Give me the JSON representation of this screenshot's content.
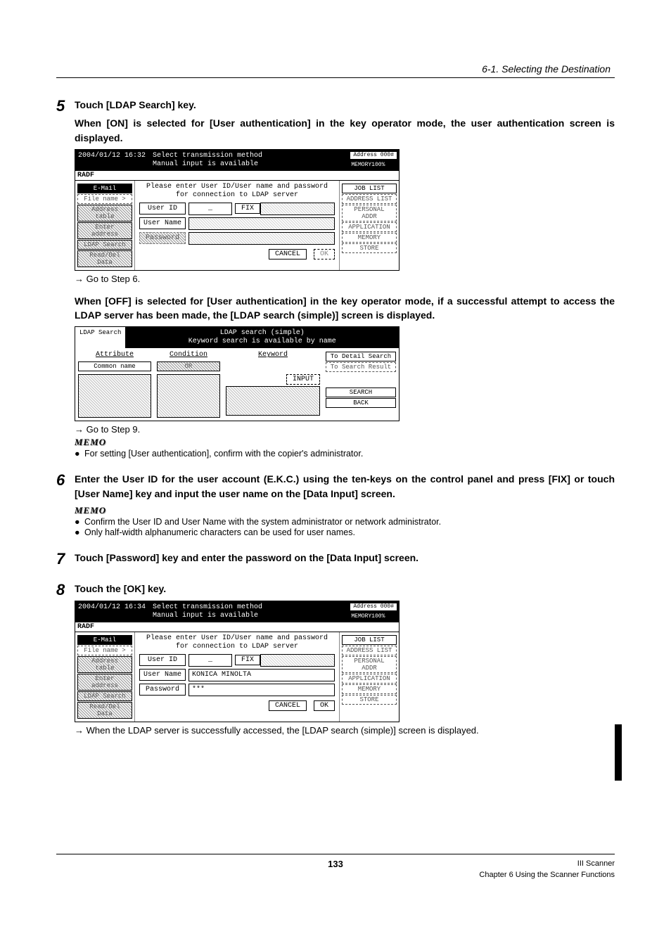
{
  "header": {
    "section": "6-1. Selecting the Destination"
  },
  "step5": {
    "num": "5",
    "title": "Touch [LDAP Search] key.",
    "para1": "When [ON] is selected for [User authentication] in the key operator mode, the user authentication screen is displayed.",
    "goto1": "→ Go to Step 6.",
    "para2": "When [OFF] is selected for [User authentication] in the key operator mode, if a successful attempt to access the LDAP server has been made, the [LDAP search (simple)] screen is displayed.",
    "goto2": "→ Go to Step 9.",
    "memo_label": "MEMO",
    "memo1": "For setting [User authentication], confirm with the copier's administrator."
  },
  "scr1": {
    "date": "2004/01/12 16:32",
    "title1": "Select transmission method",
    "title2": "Manual input is available",
    "addr_label": "Address",
    "addr_val": "000#",
    "mem": "MEMORY100%",
    "radf": "RADF",
    "tab_email": "E-Mail",
    "left_items": [
      "File name >",
      "Address table",
      "Enter address",
      "LDAP Search",
      "Read/Del Data"
    ],
    "right_items": [
      "JOB LIST",
      "ADDRESS LIST",
      "PERSONAL ADDR",
      "APPLICATION",
      "MEMORY",
      "STORE"
    ],
    "msg1": "Please enter User ID/User name and password",
    "msg2": "for connection to LDAP server",
    "f_userid": "User ID",
    "f_username": "User Name",
    "f_password": "Password",
    "userid_val": "_",
    "btn_fix": "FIX",
    "btn_cancel": "CANCEL",
    "btn_ok": "OK"
  },
  "scr2": {
    "corner": "LDAP Search",
    "title1": "LDAP search (simple)",
    "title2": "Keyword search is available by name",
    "col_attr": "Attribute",
    "col_cond": "Condition",
    "col_key": "Keyword",
    "common": "Common name",
    "or": "OR",
    "btn_input": "INPUT",
    "btn_detail": "To Detail Search",
    "btn_result": "To Search Result",
    "btn_search": "SEARCH",
    "btn_back": "BACK"
  },
  "step6": {
    "num": "6",
    "title": "Enter the User ID for the user account (E.K.C.) using the ten-keys on the control panel and press [FIX] or touch [User Name] key and input the user name on the [Data Input] screen.",
    "memo_label": "MEMO",
    "memo1": "Confirm the User ID and User Name with the system administrator or network administrator.",
    "memo2": "Only half-width alphanumeric characters can be used for user names."
  },
  "step7": {
    "num": "7",
    "title": "Touch [Password] key and enter the password on the [Data Input] screen."
  },
  "step8": {
    "num": "8",
    "title": "Touch the [OK] key.",
    "goto": "→ When the LDAP server is successfully accessed, the [LDAP search (simple)] screen is displayed."
  },
  "scr3": {
    "date": "2004/01/12 16:34",
    "title1": "Select transmission method",
    "title2": "Manual input is available",
    "addr_label": "Address",
    "addr_val": "000#",
    "mem": "MEMORY100%",
    "radf": "RADF",
    "tab_email": "E-Mail",
    "msg1": "Please enter User ID/User name and password",
    "msg2": "for connection to LDAP server",
    "f_userid": "User ID",
    "f_username": "User Name",
    "f_password": "Password",
    "userid_val": "_",
    "username_val": "KONICA MINOLTA",
    "password_val": "***",
    "btn_fix": "FIX",
    "btn_cancel": "CANCEL",
    "btn_ok": "OK",
    "right_items": [
      "JOB LIST",
      "ADDRESS LIST",
      "PERSONAL ADDR",
      "APPLICATION",
      "MEMORY",
      "STORE"
    ]
  },
  "footer": {
    "page": "133",
    "right1": "III Scanner",
    "right2": "Chapter 6 Using the Scanner Functions"
  }
}
